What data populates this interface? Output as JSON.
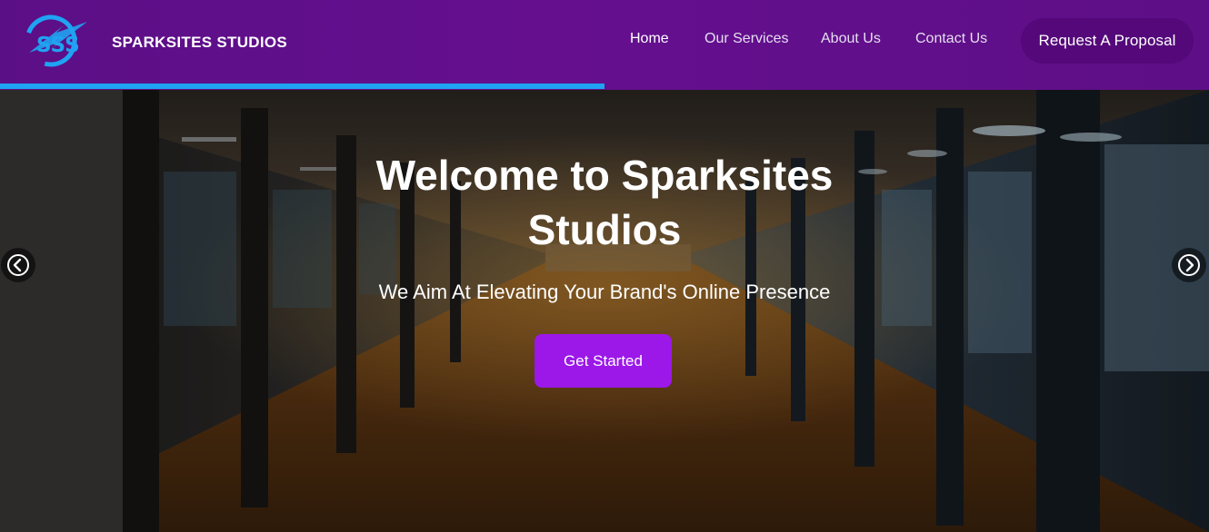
{
  "header": {
    "brand": "SPARKSITES STUDIOS",
    "logo_text": "SSS",
    "nav": [
      {
        "label": "Home",
        "active": true
      },
      {
        "label": "Our Services"
      },
      {
        "label": "About Us"
      },
      {
        "label": "Contact Us"
      }
    ],
    "cta_label": "Request A Proposal",
    "scroll_progress": 0.5,
    "colors": {
      "header_bg": "#650f8f",
      "progress": "#1fa3f2",
      "cta_bg": "#54087a"
    }
  },
  "hero": {
    "title_line1": "Welcome to Sparksites",
    "title_line2": "Studios",
    "subtitle": "We Aim At Elevating Your Brand's Online Presence",
    "button_label": "Get Started",
    "prev_icon": "chevron-left-circle-icon",
    "next_icon": "chevron-right-circle-icon",
    "colors": {
      "button_bg": "#9b18e8"
    }
  }
}
